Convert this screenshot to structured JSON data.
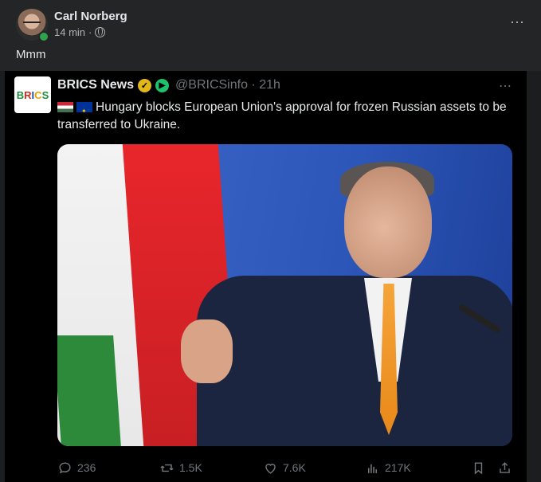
{
  "post": {
    "author": "Carl Norberg",
    "time": "14 min",
    "separator": "·",
    "text": "Mmm",
    "more_icon": "⋯"
  },
  "tweet": {
    "display_name": "BRICS News",
    "handle": "@BRICSinfo · 21h",
    "logo_letters": [
      "B",
      "R",
      "I",
      "C",
      "S"
    ],
    "text": "Hungary blocks European Union's approval for frozen Russian assets to be transferred to Ukraine.",
    "more_icon": "⋯",
    "stats": {
      "replies": "236",
      "retweets": "1.5K",
      "likes": "7.6K",
      "views": "217K"
    }
  },
  "colors": {
    "facebook_bg": "#242526",
    "tweet_bg": "#000000",
    "verified_gold": "#e2b719",
    "online_green": "#31a24c"
  }
}
